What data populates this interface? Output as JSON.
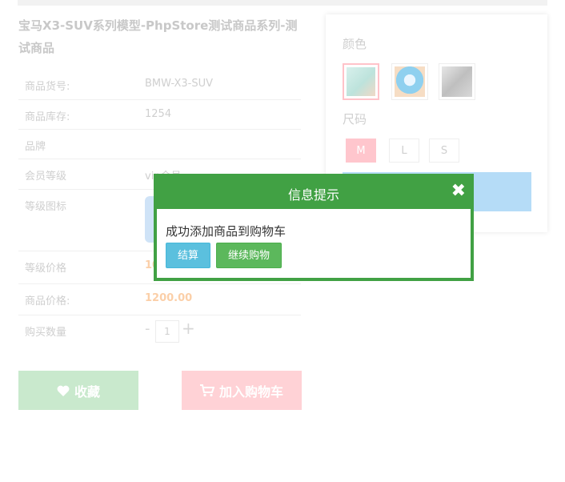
{
  "product": {
    "title": "宝马X3-SUV系列模型-PhpStore测试商品系列-测试商品",
    "rows": [
      {
        "key": "商品货号:",
        "value": "BMW-X3-SUV"
      },
      {
        "key": "商品库存:",
        "value": "1254"
      },
      {
        "key": "品牌",
        "value": ""
      },
      {
        "key": "会员等级",
        "value": "vip会员"
      },
      {
        "key": "等级图标",
        "value": ""
      },
      {
        "key": "等级价格",
        "value": "10"
      },
      {
        "key": "商品价格:",
        "value": "1200.00"
      },
      {
        "key": "购买数量",
        "value": ""
      }
    ],
    "quantity": "1",
    "qty_minus": "-",
    "qty_plus": "+"
  },
  "actions": {
    "favorite_label": "收藏",
    "favorite_icon": "heart-icon",
    "add_cart_label": "加入购物车",
    "add_cart_icon": "cart-icon"
  },
  "options": {
    "color_label": "颜色",
    "size_label": "尺码",
    "sizes": [
      "M",
      "L",
      "S"
    ],
    "selected_size": "M",
    "selected_color_index": 0
  },
  "modal": {
    "title": "信息提示",
    "close_glyph": "✖",
    "message": "成功添加商品到购物车",
    "checkout_label": "结算",
    "continue_label": "继续购物"
  },
  "colors": {
    "modal_green": "#41a144",
    "checkout_blue": "#5bc0de",
    "continue_green": "#5cb85c",
    "price_orange": "#fbcfa8",
    "favorite_bg": "#c9e9cd",
    "cart_bg": "#ffd2d6"
  }
}
